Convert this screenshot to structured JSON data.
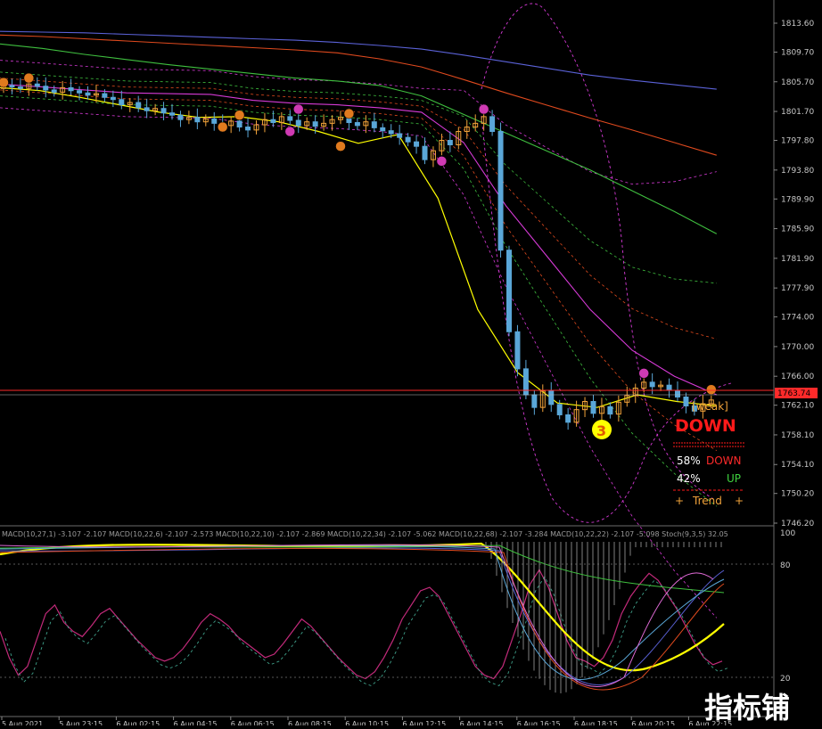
{
  "chart_data": {
    "type": "candlestick",
    "price_axis": {
      "ticks": [
        "1813.60",
        "1809.70",
        "1805.70",
        "1801.70",
        "1797.80",
        "1793.80",
        "1789.90",
        "1785.90",
        "1781.90",
        "1777.90",
        "1774.00",
        "1770.00",
        "1766.00",
        "1762.10",
        "1758.10",
        "1754.10",
        "1750.20",
        "1746.20"
      ],
      "ylim": [
        1744.0,
        1817.0
      ],
      "current_price_label": "1763.74",
      "current_price": 1763.74
    },
    "time_axis": {
      "ticks": [
        "5 Aug 2021",
        "5 Aug 23:15",
        "6 Aug 02:15",
        "6 Aug 04:15",
        "6 Aug 06:15",
        "6 Aug 08:15",
        "6 Aug 10:15",
        "6 Aug 12:15",
        "6 Aug 14:15",
        "6 Aug 16:15",
        "6 Aug 18:15",
        "6 Aug 20:15",
        "6 Aug 22:15"
      ]
    },
    "candles_close": [
      1805.2,
      1805.0,
      1804.8,
      1805.4,
      1805.1,
      1804.6,
      1804.3,
      1804.9,
      1804.5,
      1804.2,
      1803.9,
      1804.1,
      1803.6,
      1803.3,
      1802.6,
      1802.9,
      1802.2,
      1801.8,
      1802.1,
      1801.5,
      1801.2,
      1800.6,
      1800.9,
      1800.3,
      1800.7,
      1800.1,
      1799.8,
      1800.4,
      1799.6,
      1799.2,
      1799.9,
      1800.6,
      1800.2,
      1801.0,
      1800.5,
      1799.8,
      1800.3,
      1799.7,
      1800.1,
      1800.6,
      1800.9,
      1800.2,
      1799.8,
      1800.3,
      1799.5,
      1799.1,
      1798.7,
      1798.2,
      1797.6,
      1797.0,
      1795.2,
      1796.4,
      1797.8,
      1797.2,
      1799.0,
      1799.6,
      1800.1,
      1801.0,
      1799.0,
      1783.0,
      1772.0,
      1767.0,
      1763.5,
      1761.8,
      1764.0,
      1762.2,
      1760.8,
      1759.8,
      1761.5,
      1762.6,
      1761.0,
      1761.9,
      1760.9,
      1762.5,
      1763.4,
      1764.4,
      1765.2,
      1764.6,
      1764.8,
      1764.1,
      1763.2,
      1762.0,
      1761.3,
      1762.3,
      1762.8
    ],
    "candles_open": [
      1804.8,
      1805.2,
      1805.0,
      1804.8,
      1805.4,
      1805.1,
      1804.6,
      1804.3,
      1804.9,
      1804.5,
      1804.2,
      1803.9,
      1804.1,
      1803.6,
      1803.3,
      1802.6,
      1802.9,
      1802.2,
      1801.8,
      1802.1,
      1801.5,
      1801.2,
      1800.6,
      1800.9,
      1800.3,
      1800.7,
      1800.1,
      1799.8,
      1800.4,
      1799.6,
      1799.2,
      1799.9,
      1800.6,
      1800.2,
      1801.0,
      1800.5,
      1799.8,
      1800.3,
      1799.7,
      1800.1,
      1800.6,
      1800.9,
      1800.2,
      1799.8,
      1800.3,
      1799.5,
      1799.1,
      1798.7,
      1798.2,
      1797.6,
      1797.0,
      1795.2,
      1796.4,
      1797.8,
      1797.2,
      1799.0,
      1799.6,
      1800.1,
      1801.0,
      1799.0,
      1783.0,
      1772.0,
      1767.0,
      1763.5,
      1761.8,
      1764.0,
      1762.2,
      1760.8,
      1759.8,
      1761.5,
      1762.6,
      1761.0,
      1761.9,
      1760.9,
      1762.5,
      1763.4,
      1764.4,
      1765.2,
      1764.6,
      1764.8,
      1764.1,
      1763.2,
      1762.0,
      1761.3,
      1762.3
    ],
    "series": [
      {
        "values": [
          1812.5,
          1812.4,
          1812.3,
          1812.1,
          1811.9,
          1811.7,
          1811.5,
          1811.3,
          1811.0,
          1810.6,
          1810.1,
          1809.3,
          1808.4,
          1807.5,
          1806.6,
          1805.9,
          1805.3,
          1804.7
        ]
      },
      {
        "values": [
          1812.0,
          1811.8,
          1811.5,
          1811.2,
          1810.9,
          1810.6,
          1810.3,
          1810.0,
          1809.6,
          1808.8,
          1807.7,
          1806.0,
          1804.2,
          1802.5,
          1800.8,
          1799.2,
          1797.5,
          1795.8
        ]
      },
      {
        "values": [
          1810.8,
          1810.2,
          1809.4,
          1808.7,
          1808.0,
          1807.4,
          1806.8,
          1806.2,
          1805.8,
          1805.2,
          1803.8,
          1801.3,
          1798.8,
          1796.3,
          1793.8,
          1791.0,
          1788.2,
          1785.2
        ]
      },
      {
        "values": [
          1805.4,
          1805.0,
          1804.6,
          1804.2,
          1804.1,
          1804.0,
          1803.2,
          1802.8,
          1802.6,
          1802.2,
          1801.6,
          1797.5,
          1789.0,
          1782.0,
          1775.0,
          1769.5,
          1766.0,
          1763.5
        ]
      },
      {
        "values": [
          1804.9,
          1804.5,
          1803.6,
          1802.6,
          1801.6,
          1800.9,
          1801.0,
          1800.3,
          1799.0,
          1797.4,
          1798.6,
          1790.0,
          1775.0,
          1766.5,
          1762.4,
          1761.8,
          1763.5,
          1762.6,
          1762.0
        ]
      }
    ],
    "signal_pane": {
      "header": "MACD(10,27,1) -3.107 -2.107  MACD(10,22,6) -2.107 -2.573  MACD(10,22,10) -2.107 -2.869  MACD(10,22,34) -2.107 -5.062  MACD(10,22,68) -2.107 -3.284  MACD(10,22,22) -2.107 -5.098  Stoch(9,3,5) 32.05",
      "levels": [
        "100",
        "80",
        "20"
      ],
      "stoch_values": [
        45,
        30,
        20,
        25,
        40,
        55,
        60,
        50,
        45,
        42,
        48,
        55,
        58,
        52,
        46,
        40,
        35,
        30,
        28,
        30,
        35,
        42,
        50,
        55,
        52,
        48,
        42,
        38,
        34,
        30,
        32,
        38,
        45,
        52,
        48,
        42,
        36,
        30,
        25,
        20,
        18,
        22,
        30,
        40,
        52,
        60,
        68,
        70,
        65,
        55,
        45,
        35,
        25,
        20,
        18,
        25,
        40,
        55,
        72,
        80,
        70,
        55,
        40,
        30,
        28,
        25,
        30,
        40,
        55,
        65,
        72,
        78,
        74,
        66,
        58,
        48,
        38,
        30,
        26,
        28
      ]
    },
    "annotations": {
      "wave_label": "3",
      "status_label": "DOWN",
      "weak_label": "[weak]",
      "down_pct_label": "58%",
      "down_pct_value": 58,
      "down_word": "DOWN",
      "up_pct_label": "42%",
      "up_pct_value": 42,
      "up_word": "UP",
      "trend_plus_left": "+",
      "trend_word": "Trend",
      "trend_plus_right": "+"
    },
    "colors": {
      "background": "#000000",
      "candle_up": "#f2a33a",
      "candle_down": "#5aa7d8",
      "accent_red": "#ff1a1a",
      "accent_yellow": "#ffff00",
      "magenta": "#d63ad6",
      "blue_ma": "#5b62d8",
      "orange_ma": "#e04a1e",
      "green_ma": "#3fbf3f"
    }
  },
  "watermark": "指标铺"
}
